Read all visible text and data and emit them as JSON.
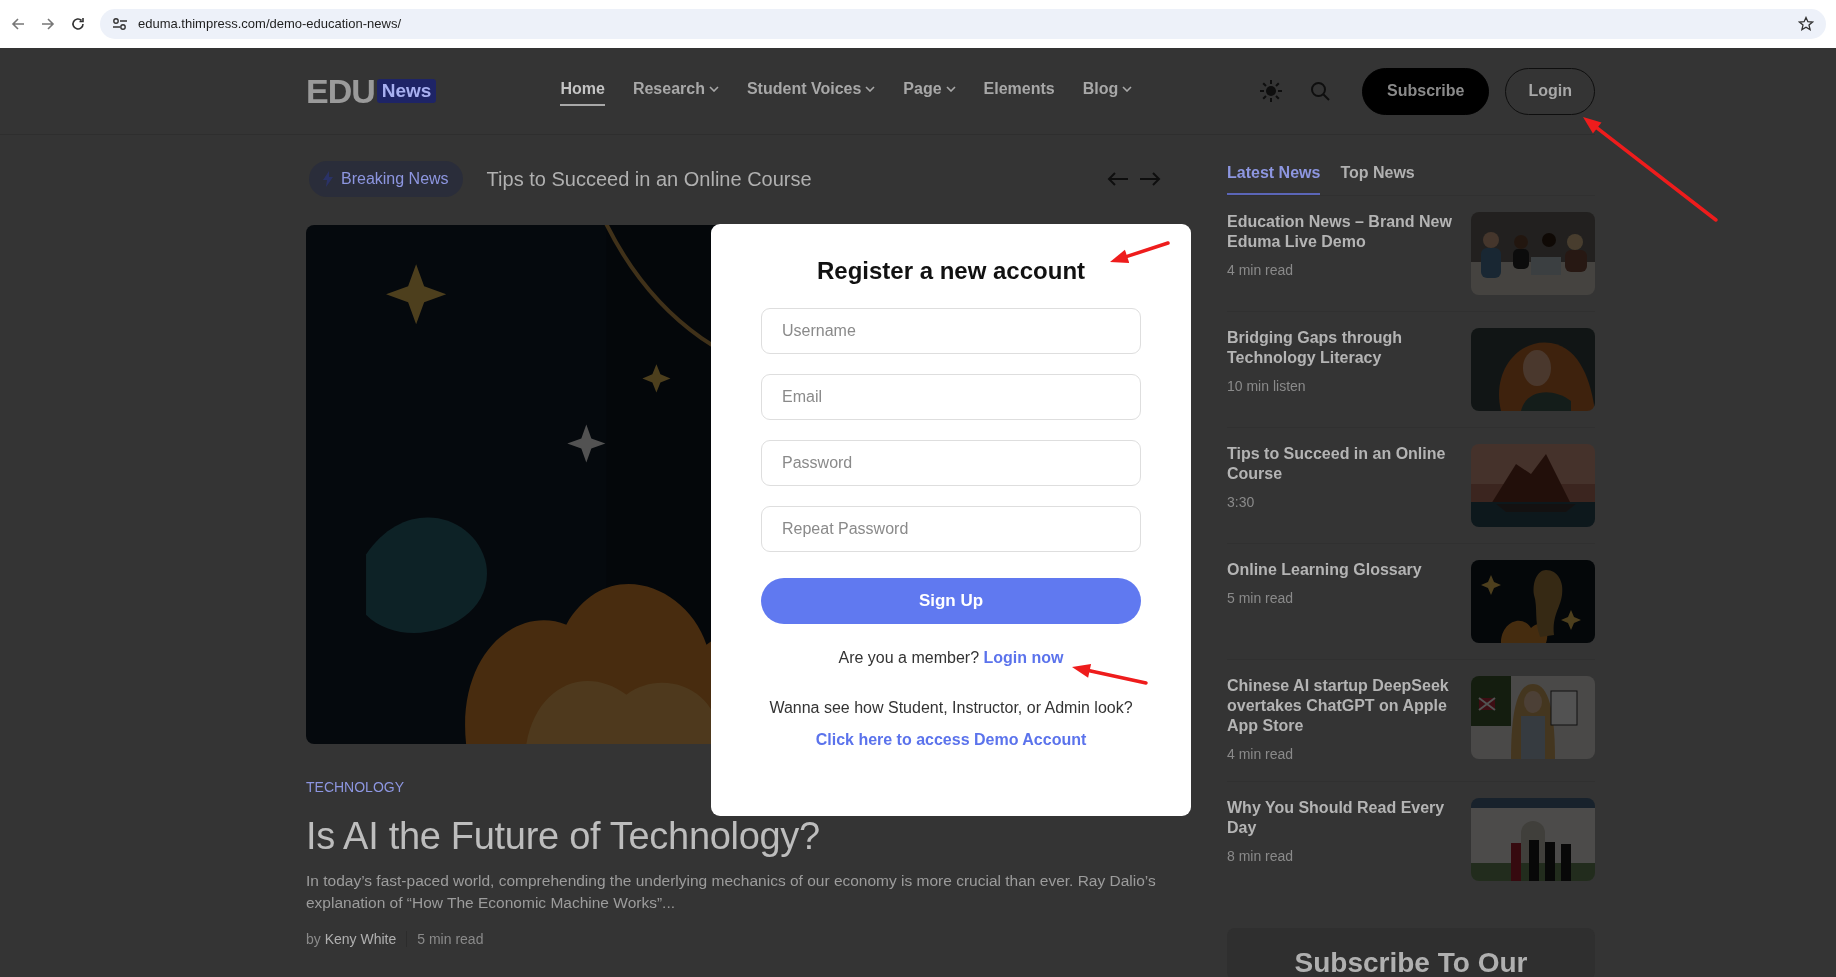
{
  "browser": {
    "url": "eduma.thimpress.com/demo-education-news/"
  },
  "header": {
    "logo": {
      "text": "EDU",
      "badge": "News"
    },
    "nav": [
      {
        "label": "Home",
        "selected": true,
        "dropdown": false
      },
      {
        "label": "Research",
        "selected": false,
        "dropdown": true
      },
      {
        "label": "Student Voices",
        "selected": false,
        "dropdown": true
      },
      {
        "label": "Page",
        "selected": false,
        "dropdown": true
      },
      {
        "label": "Elements",
        "selected": false,
        "dropdown": false
      },
      {
        "label": "Blog",
        "selected": false,
        "dropdown": true
      }
    ],
    "buttons": [
      {
        "label": "Subscribe",
        "kind": "filled"
      },
      {
        "label": "Login",
        "kind": "outline"
      }
    ]
  },
  "breaking": {
    "label": "Breaking News",
    "headline": "Tips to Succeed in an Online Course"
  },
  "feature": {
    "category": "TECHNOLOGY",
    "title": "Is AI the Future of Technology?",
    "excerpt": "In today’s fast-paced world, comprehending the underlying mechanics of our economy is more crucial than ever. Ray Dalio’s explanation of “How The Economic Machine Works”...",
    "by": "by",
    "author": "Keny White",
    "read_time": "5 min read"
  },
  "sidebar": {
    "tabs": [
      {
        "label": "Latest News",
        "selected": true
      },
      {
        "label": "Top News",
        "selected": false
      }
    ],
    "items": [
      {
        "title": "Education News – Brand New Eduma Live Demo",
        "meta": "4 min read"
      },
      {
        "title": "Bridging Gaps through Technology Literacy",
        "meta": "10 min listen"
      },
      {
        "title": "Tips to Succeed in an Online Course",
        "meta": "3:30"
      },
      {
        "title": "Online Learning Glossary",
        "meta": "5 min read"
      },
      {
        "title": "Chinese AI startup DeepSeek overtakes ChatGPT on Apple App Store",
        "meta": "4 min read"
      },
      {
        "title": "Why You Should Read Every Day",
        "meta": "8 min read"
      }
    ],
    "subscribe_title": "Subscribe To Our"
  },
  "modal": {
    "title": "Register a new account",
    "fields": [
      {
        "placeholder": "Username"
      },
      {
        "placeholder": "Email"
      },
      {
        "placeholder": "Password"
      },
      {
        "placeholder": "Repeat Password"
      }
    ],
    "submit": "Sign Up",
    "member_prompt": "Are you a member?",
    "login_link": "Login now",
    "demo_prompt": "Wanna see how Student, Instructor, or Admin look?",
    "demo_link": "Click here to access Demo Account"
  }
}
